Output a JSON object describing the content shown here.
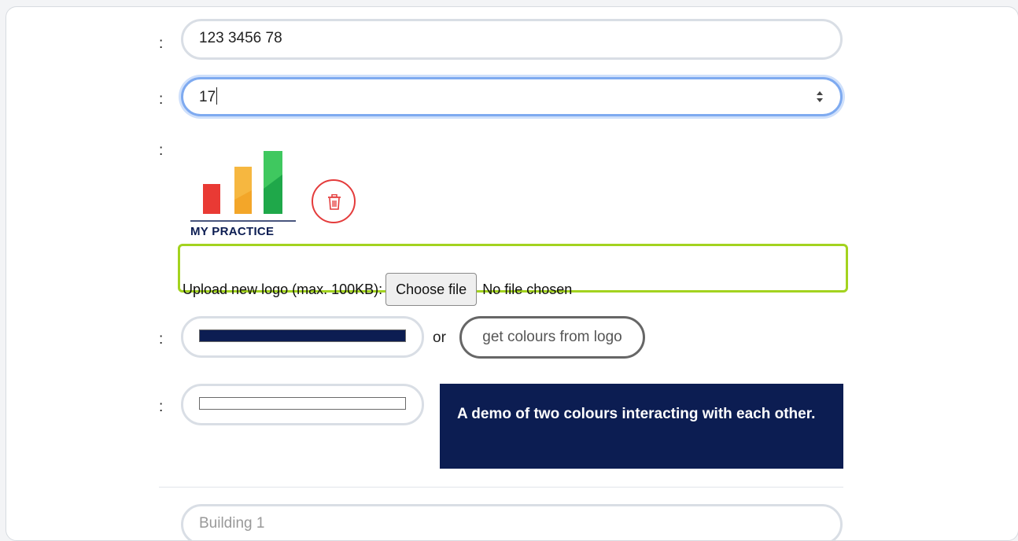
{
  "form": {
    "colon": ":",
    "phone": {
      "value": "123 3456 78"
    },
    "number": {
      "value": "17"
    },
    "logo": {
      "brand_text": "MY PRACTICE",
      "bar_colors": [
        "#e93a34",
        "#f3a629",
        "#2fbd55"
      ],
      "delete_icon": "trash-icon"
    },
    "upload": {
      "label": "Upload new logo (max. 100KB):",
      "button": "Choose file",
      "status": "No file chosen"
    },
    "primary_colour": {
      "value": "#0c1d52"
    },
    "or_text": "or",
    "get_colours_button": "get colours from logo",
    "secondary_colour": {
      "value": "#ffffff"
    },
    "demo_text": "A demo of two colours interacting with each other.",
    "next_field_placeholder": "Building 1"
  },
  "colors": {
    "focus_ring": "#7eaaf0",
    "highlight_box": "#a3d31f",
    "delete_red": "#e43c3c",
    "brand_navy": "#0c1d52"
  }
}
